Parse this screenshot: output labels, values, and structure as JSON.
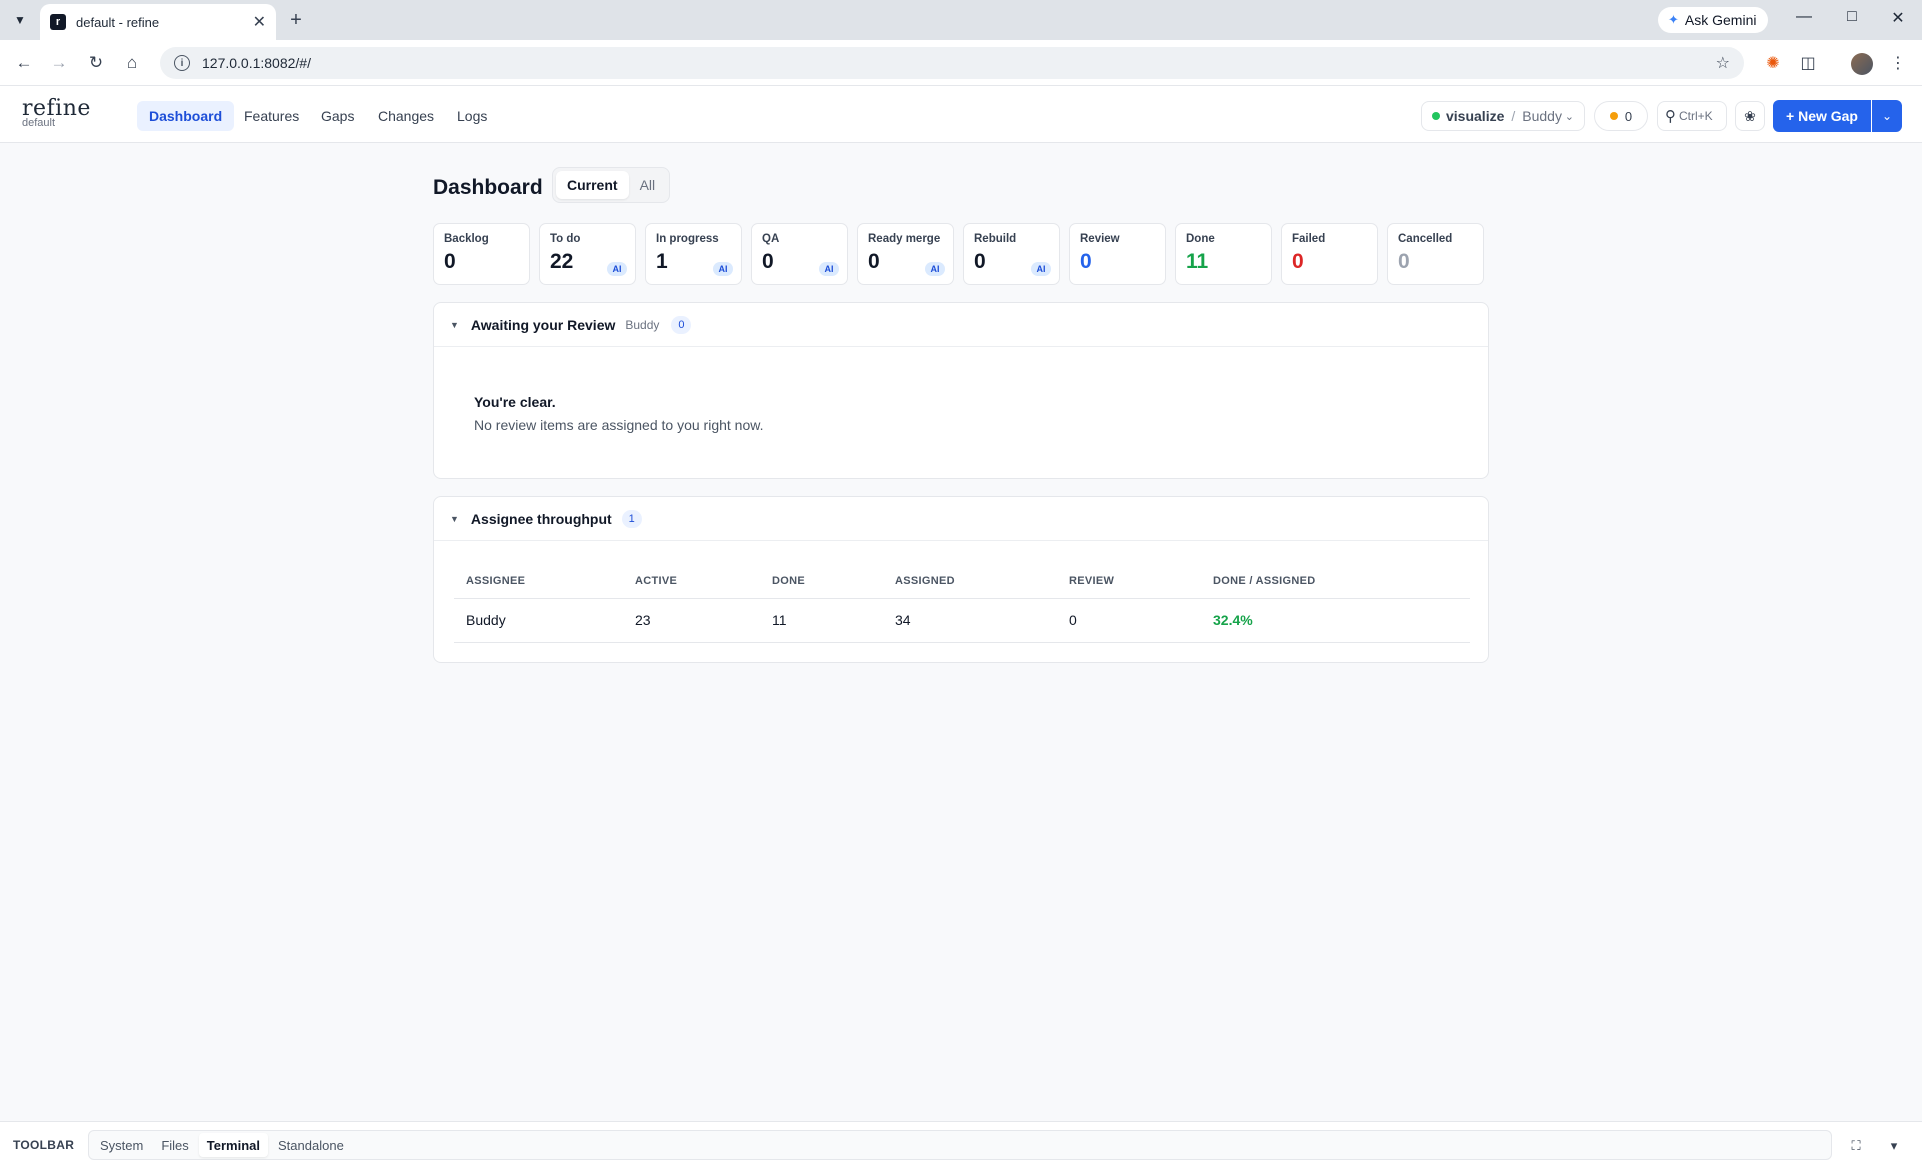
{
  "browser": {
    "tab_title": "default - refine",
    "tab_favicon_letter": "r",
    "url": "127.0.0.1:8082/#/",
    "ask_gemini": "Ask Gemini"
  },
  "app": {
    "brand": "refine",
    "workspace": "default",
    "nav": [
      {
        "label": "Dashboard",
        "active": true
      },
      {
        "label": "Features",
        "active": false
      },
      {
        "label": "Gaps",
        "active": false
      },
      {
        "label": "Changes",
        "active": false
      },
      {
        "label": "Logs",
        "active": false
      }
    ],
    "context": {
      "project": "visualize",
      "separator": "/",
      "user": "Buddy"
    },
    "notifications_count": "0",
    "search_shortcut": "Ctrl+K",
    "new_button": "+ New Gap",
    "colors": {
      "accent": "#2563eb",
      "active_tab_bg": "#eaf1ff",
      "success": "#16a34a",
      "danger": "#dc2626",
      "muted": "#9ca3af"
    }
  },
  "dashboard": {
    "title": "Dashboard",
    "segments": [
      {
        "label": "Current",
        "active": true
      },
      {
        "label": "All",
        "active": false
      }
    ],
    "stats": [
      {
        "label": "Backlog",
        "value": "0",
        "ai": false,
        "color": "#111827"
      },
      {
        "label": "To do",
        "value": "22",
        "ai": true,
        "color": "#111827"
      },
      {
        "label": "In progress",
        "value": "1",
        "ai": true,
        "color": "#111827"
      },
      {
        "label": "QA",
        "value": "0",
        "ai": true,
        "color": "#111827"
      },
      {
        "label": "Ready merge",
        "value": "0",
        "ai": true,
        "color": "#111827"
      },
      {
        "label": "Rebuild",
        "value": "0",
        "ai": true,
        "color": "#111827"
      },
      {
        "label": "Review",
        "value": "0",
        "ai": false,
        "color": "#2563eb"
      },
      {
        "label": "Done",
        "value": "11",
        "ai": false,
        "color": "#16a34a"
      },
      {
        "label": "Failed",
        "value": "0",
        "ai": false,
        "color": "#dc2626"
      },
      {
        "label": "Cancelled",
        "value": "0",
        "ai": false,
        "color": "#9ca3af"
      }
    ],
    "ai_badge": "AI",
    "review": {
      "title": "Awaiting your Review",
      "user": "Buddy",
      "count": "0",
      "empty_title": "You're clear.",
      "empty_desc": "No review items are assigned to you right now."
    },
    "throughput": {
      "title": "Assignee throughput",
      "count": "1",
      "columns": [
        "ASSIGNEE",
        "ACTIVE",
        "DONE",
        "ASSIGNED",
        "REVIEW",
        "DONE / ASSIGNED"
      ],
      "rows": [
        {
          "assignee": "Buddy",
          "active": "23",
          "done": "11",
          "assigned": "34",
          "review": "0",
          "ratio": "32.4%"
        }
      ]
    }
  },
  "toolbar": {
    "label": "TOOLBAR",
    "tabs": [
      {
        "label": "System",
        "active": false
      },
      {
        "label": "Files",
        "active": false
      },
      {
        "label": "Terminal",
        "active": true
      },
      {
        "label": "Standalone",
        "active": false
      }
    ]
  }
}
